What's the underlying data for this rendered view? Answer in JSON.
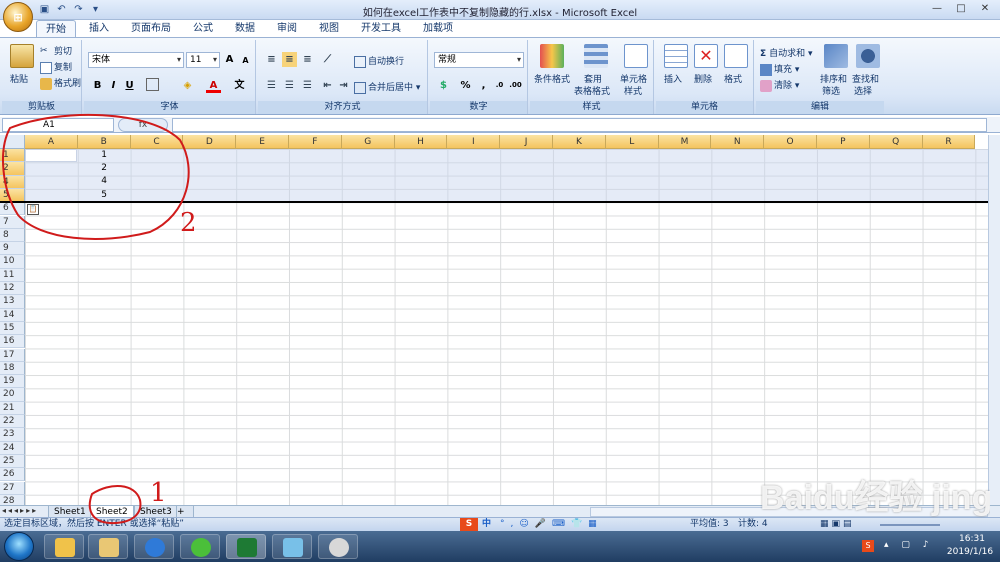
{
  "window": {
    "title": "如何在excel工作表中不复制隐藏的行.xlsx - Microsoft Excel",
    "qat_icons": [
      "save-icon",
      "undo-icon",
      "redo-icon",
      "quick-access-more-icon"
    ],
    "controls": [
      "—",
      "□",
      "✕"
    ]
  },
  "ribbon_tabs": [
    "开始",
    "插入",
    "页面布局",
    "公式",
    "数据",
    "审阅",
    "视图",
    "开发工具",
    "加载项"
  ],
  "ribbon": {
    "clipboard": {
      "label": "剪贴板",
      "paste": "粘贴",
      "cut": "剪切",
      "copy": "复制",
      "format_painter": "格式刷"
    },
    "font": {
      "label": "字体",
      "font_name": "宋体",
      "font_size": "11",
      "bold": "B",
      "italic": "I",
      "underline": "U",
      "grow": "A",
      "shrink": "A",
      "color_letter": "A",
      "wen": "文"
    },
    "alignment": {
      "label": "对齐方式",
      "wrap": "自动换行",
      "merge": "合并后居中"
    },
    "number": {
      "label": "数字",
      "format": "常规",
      "percent": "%",
      "comma": ","
    },
    "styles": {
      "label": "样式",
      "conditional": "条件格式",
      "table_line1": "套用",
      "table_line2": "表格格式",
      "cell_style_line1": "单元格",
      "cell_style_line2": "样式"
    },
    "cells": {
      "label": "单元格",
      "insert": "插入",
      "delete": "删除",
      "format": "格式"
    },
    "editing": {
      "label": "编辑",
      "autosum": "自动求和",
      "fill": "填充",
      "clear": "清除",
      "sort_line1": "排序和",
      "sort_line2": "筛选",
      "find_line1": "查找和",
      "find_line2": "选择"
    }
  },
  "formula_bar": {
    "name_box": "A1",
    "fx": "fx",
    "value": ""
  },
  "columns": [
    "A",
    "B",
    "C",
    "D",
    "E",
    "F",
    "G",
    "H",
    "I",
    "J",
    "K",
    "L",
    "M",
    "N",
    "O",
    "P",
    "Q",
    "R"
  ],
  "rows": [
    "1",
    "2",
    "4",
    "5",
    "6",
    "7",
    "8",
    "9",
    "10",
    "11",
    "12",
    "13",
    "14",
    "15",
    "16",
    "17",
    "18",
    "19",
    "20",
    "21",
    "22",
    "23",
    "24",
    "25",
    "26",
    "27",
    "28"
  ],
  "cells": {
    "b1": "1",
    "b2": "2",
    "b4": "4",
    "b5": "5"
  },
  "sheet_tabs": [
    "Sheet1",
    "Sheet2",
    "Sheet3"
  ],
  "active_sheet": "Sheet2",
  "status": {
    "message": "选定目标区域，然后按 ENTER 或选择“粘贴”",
    "average": "平均值: 3",
    "count": "计数: 4",
    "ime": "中"
  },
  "taskbar": {
    "apps": [
      "wechat-folder-icon",
      "explorer-icon",
      "sogou-browser-icon",
      "wechat-icon",
      "excel-icon",
      "notepad-icon",
      "paint-icon"
    ],
    "time": "16:31",
    "date": "2019/1/16"
  },
  "annotations": {
    "mark1": "1",
    "mark2": "2"
  },
  "watermark": "Baidu经验 jingyan.baidu.com",
  "colors": {
    "accent": "#15386b",
    "header_highlight": "#f4c45f",
    "selection": "#c6d3ee",
    "annotation": "#d01b1b"
  }
}
